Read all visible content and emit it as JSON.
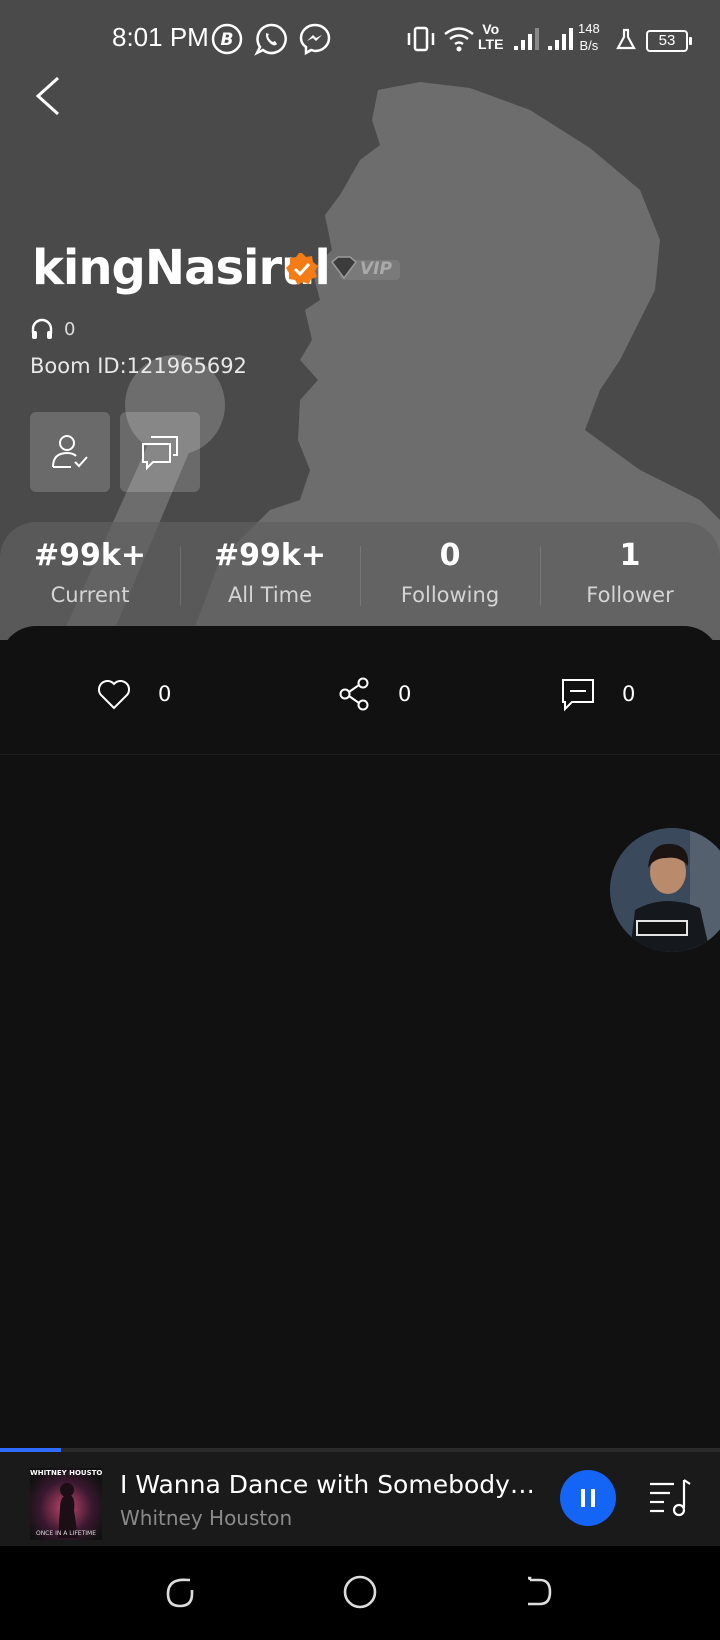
{
  "status_bar": {
    "time": "8:01 PM",
    "network_speed_value": "148",
    "network_speed_unit": "B/s",
    "battery": "53",
    "icons": [
      "b-app-icon",
      "whatsapp-icon",
      "messenger-icon",
      "vibrate-icon",
      "wifi-icon",
      "volte-icon",
      "signal-icon",
      "signal-icon",
      "flask-icon",
      "battery-icon"
    ],
    "volte_line1": "Vo",
    "volte_line2": "LTE"
  },
  "profile": {
    "username": "kingNasirul",
    "vip_label": "VIP",
    "listen_count": "0",
    "boom_id": "Boom ID:121965692",
    "colors": {
      "verified_badge": "#f57c14",
      "header_bg": "#4a4a4a"
    }
  },
  "stats": [
    {
      "value": "#99k+",
      "label": "Current"
    },
    {
      "value": "#99k+",
      "label": "All Time"
    },
    {
      "value": "0",
      "label": "Following"
    },
    {
      "value": "1",
      "label": "Follower"
    }
  ],
  "interactions": {
    "likes": "0",
    "shares": "0",
    "comments": "0"
  },
  "player": {
    "title": "I Wanna Dance with Somebody (Live)",
    "artist": "Whitney Houston",
    "cover_top_text": "WHITNEY HOUSTON",
    "cover_bottom_text": "ONCE IN A LIFETIME",
    "progress": 0.085,
    "accent_color": "#1464f5"
  },
  "navbar": {
    "icons": [
      "recents-icon",
      "home-icon",
      "back-nav-icon"
    ]
  }
}
